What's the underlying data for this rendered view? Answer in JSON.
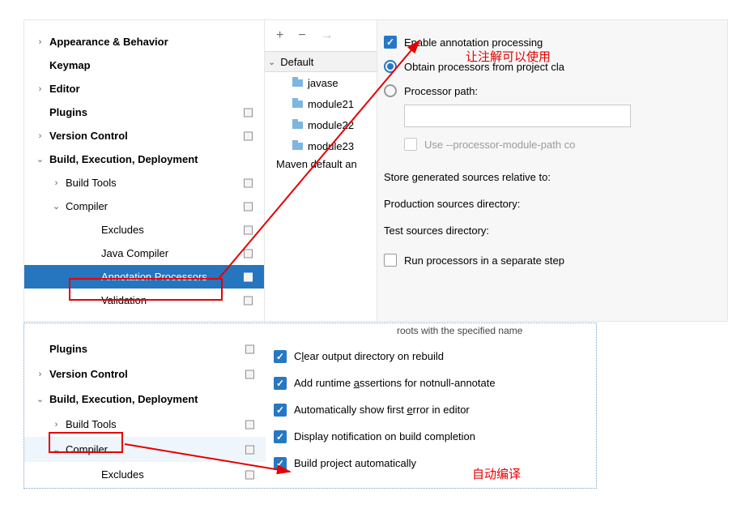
{
  "tree_top": {
    "appearance": "Appearance & Behavior",
    "keymap": "Keymap",
    "editor": "Editor",
    "plugins": "Plugins",
    "vcs": "Version Control",
    "build": "Build, Execution, Deployment",
    "build_tools": "Build Tools",
    "compiler": "Compiler",
    "excludes": "Excludes",
    "java_compiler": "Java Compiler",
    "annotation_processors": "Annotation Processors",
    "validation": "Validation"
  },
  "mid": {
    "default_group": "Default",
    "modules": [
      "javase",
      "module21",
      "module22",
      "module23"
    ],
    "maven_default": "Maven default an"
  },
  "right_top": {
    "enable_ap": "Enable annotation processing",
    "obtain_proc": "Obtain processors from project cla",
    "proc_path": "Processor path:",
    "use_module_path": "Use --processor-module-path co",
    "store_rel": "Store generated sources relative to:",
    "prod_dir": "Production sources directory:",
    "test_dir": "Test sources directory:",
    "run_separate": "Run processors in a separate step"
  },
  "anno": {
    "cn1": "让注解可以使用",
    "cn2": "自动编译"
  },
  "tree_bot": {
    "plugins": "Plugins",
    "vcs": "Version Control",
    "build": "Build, Execution, Deployment",
    "build_tools": "Build Tools",
    "compiler": "Compiler",
    "excludes": "Excludes"
  },
  "right_bot": {
    "context": "roots with the specified name",
    "clear_output_pre": "C",
    "clear_output_u": "l",
    "clear_output_post": "ear output directory on rebuild",
    "add_runtime_pre": "Add runtime ",
    "add_runtime_u": "a",
    "add_runtime_post": "ssertions for notnull-annotate",
    "auto_err_pre": "Automatically show first ",
    "auto_err_u": "e",
    "auto_err_post": "rror in editor",
    "display_notif": "Display notification on build completion",
    "build_auto": "Build project automatically"
  }
}
